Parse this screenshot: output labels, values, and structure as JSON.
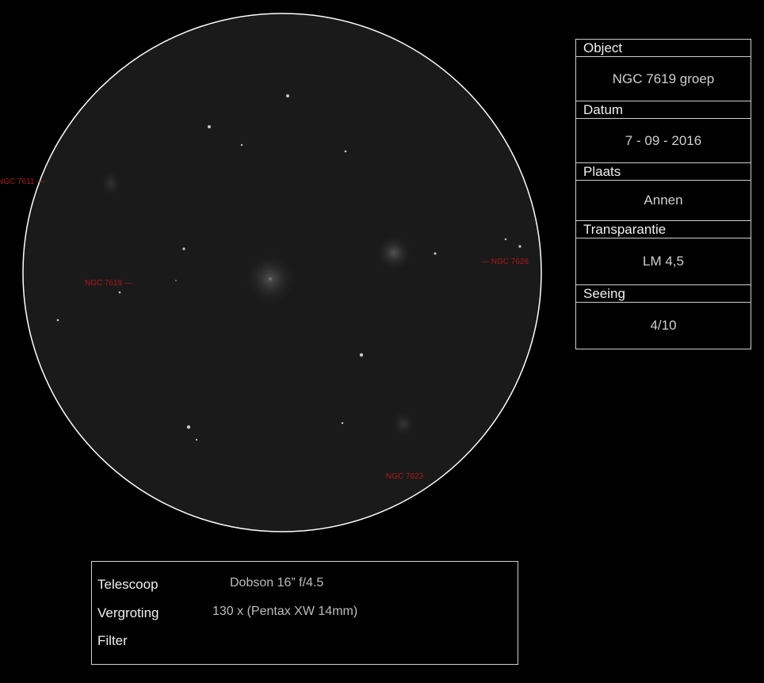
{
  "info": {
    "object_label": "Object",
    "object_value": "NGC 7619 groep",
    "date_label": "Datum",
    "date_value": "7 - 09 - 2016",
    "place_label": "Plaats",
    "place_value": "Annen",
    "transparency_label": "Transparantie",
    "transparency_value": "LM 4,5",
    "seeing_label": "Seeing",
    "seeing_value": "4/10"
  },
  "equipment": {
    "telescope_label": "Telescoop",
    "telescope_value": "Dobson 16” f/4.5",
    "magnification_label": "Vergroting",
    "magnification_value": "130 x (Pentax XW 14mm)",
    "filter_label": "Filter",
    "filter_value": ""
  },
  "labels": {
    "ngc7611": "NGC 7611 —",
    "ngc7619": "NGC 7619 —",
    "ngc7626": "— NGC 7626",
    "ngc7623": "NGC 7623"
  },
  "colors": {
    "background": "#000000",
    "field": "#1a1a1a",
    "circle": "#ffffff",
    "label_red": "#b01818",
    "text": "#cfcfcf"
  }
}
